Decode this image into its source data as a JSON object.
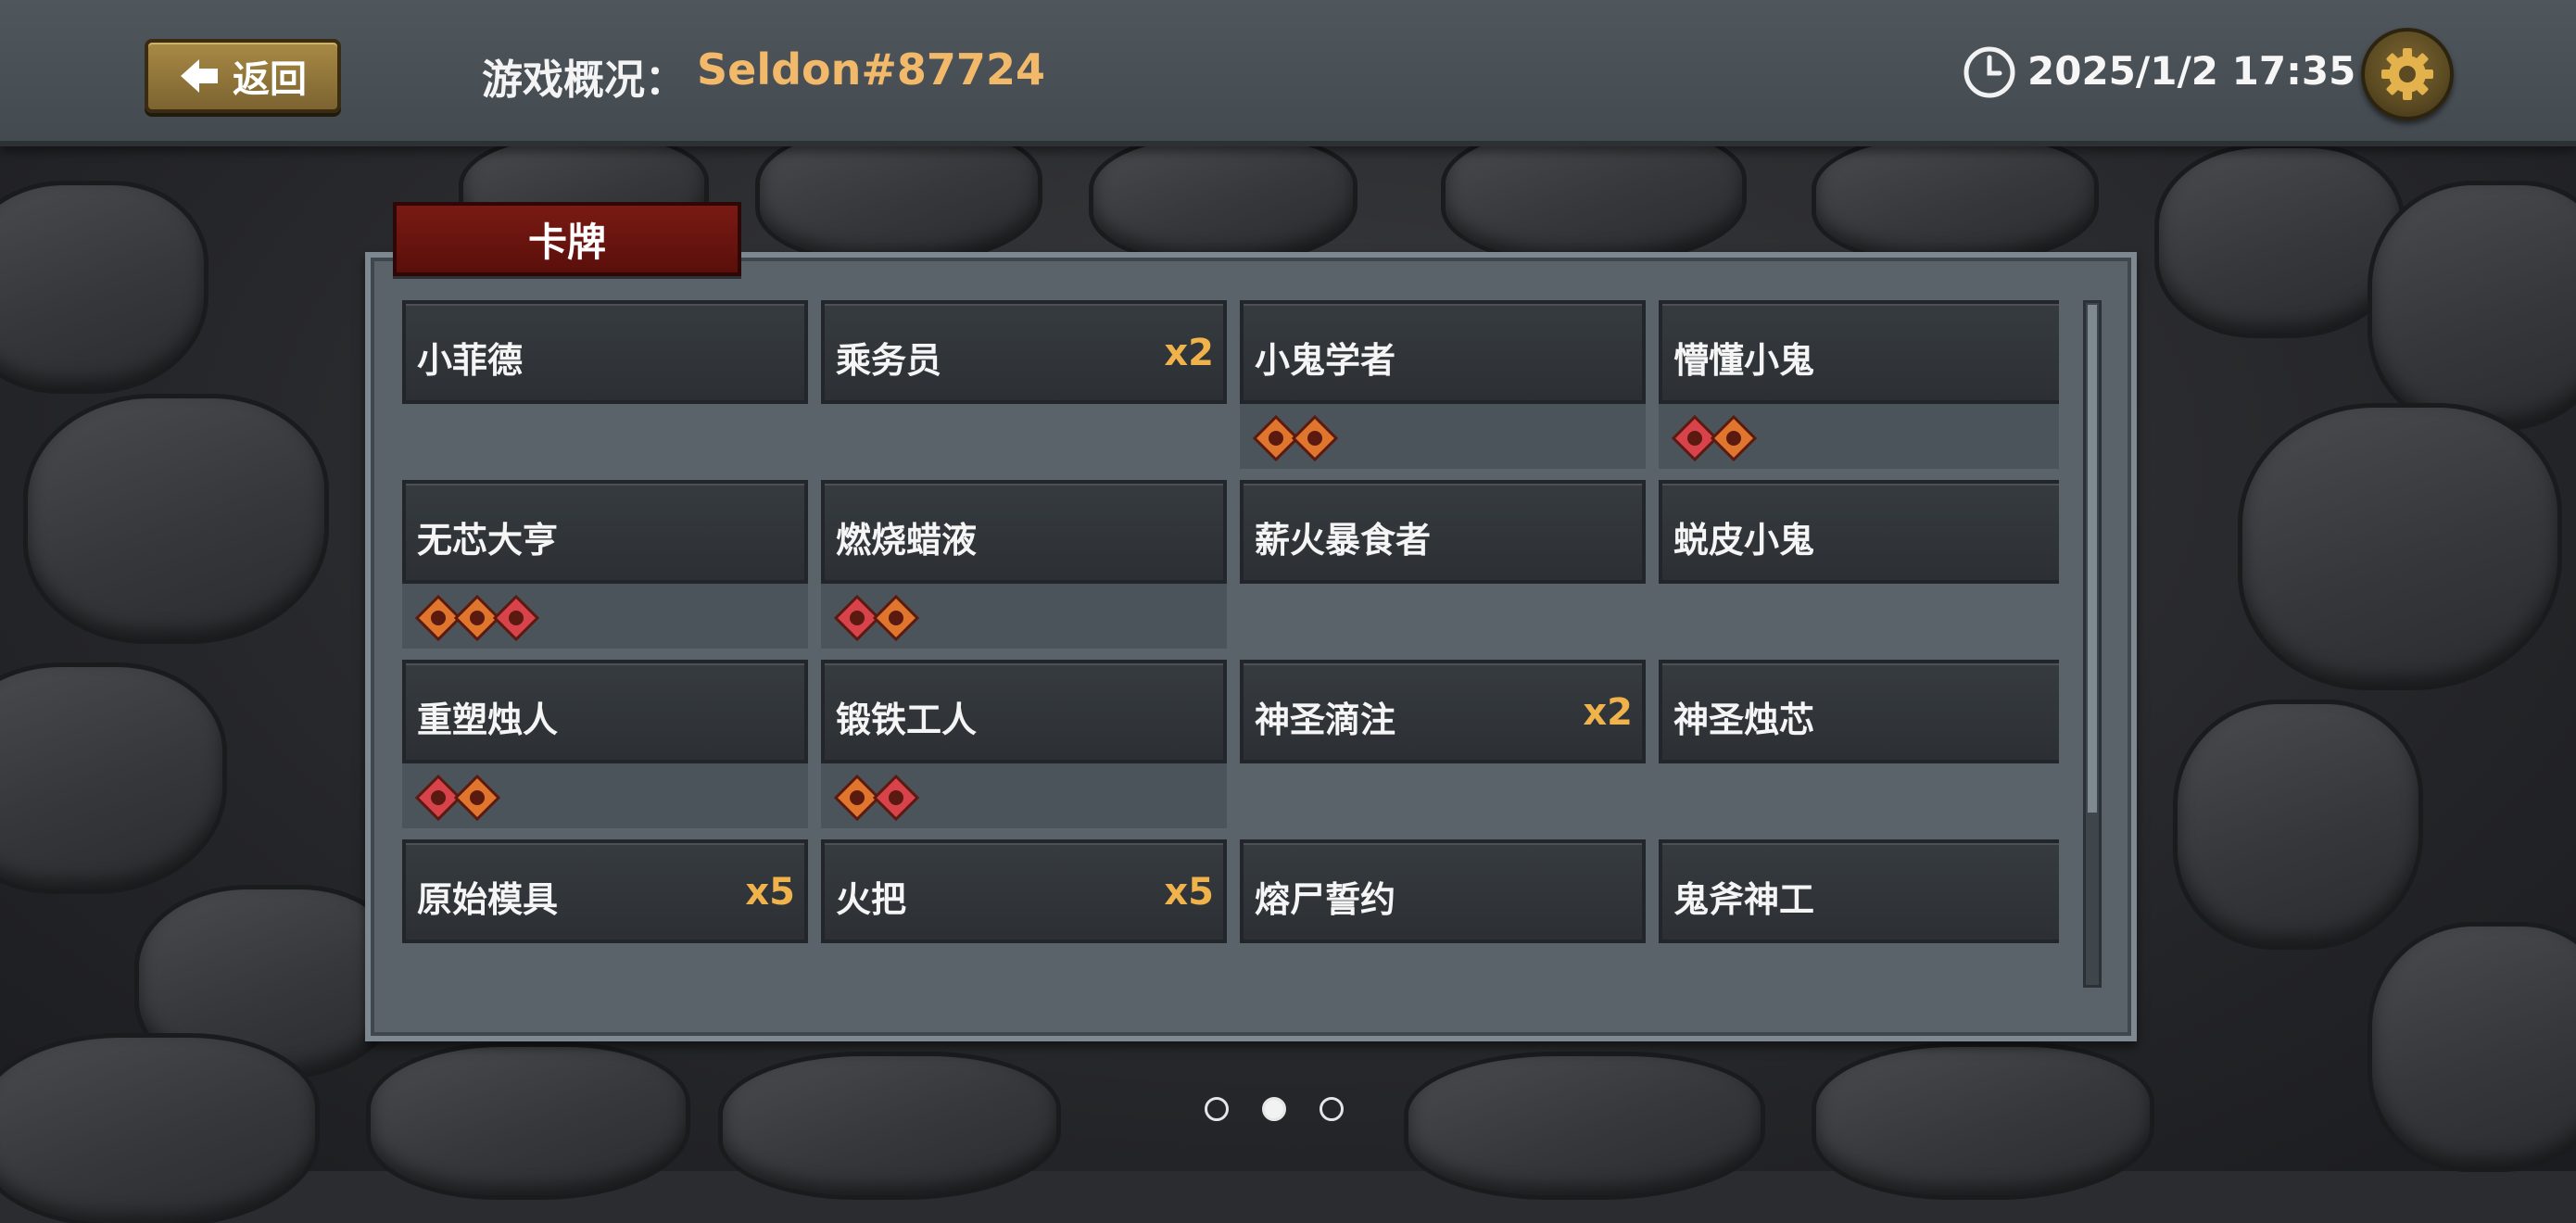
{
  "header": {
    "back_label": "返回",
    "title_prefix": "游戏概况：",
    "username": "Seldon#87724",
    "datetime": "2025/1/2 17:35",
    "icons": {
      "back": "left-arrow-icon",
      "clock": "clock-icon",
      "settings": "gear-icon"
    }
  },
  "panel": {
    "tab_label": "卡牌",
    "cards": [
      {
        "name": "小菲德",
        "count": "",
        "badges": []
      },
      {
        "name": "乘务员",
        "count": "x2",
        "badges": []
      },
      {
        "name": "小鬼学者",
        "count": "",
        "badges": [
          "skull-badge-icon",
          "heart-badge-icon"
        ]
      },
      {
        "name": "懵懂小鬼",
        "count": "",
        "badges": [
          "sword-badge-icon",
          "dagger-badge-icon"
        ]
      },
      {
        "name": "无芯大亨",
        "count": "",
        "badges": [
          "cup-badge-icon",
          "dagger-badge-icon",
          "gem-badge-icon"
        ]
      },
      {
        "name": "燃烧蜡液",
        "count": "",
        "badges": [
          "infinity-badge-icon",
          "skull-badge-icon"
        ]
      },
      {
        "name": "薪火暴食者",
        "count": "",
        "badges": []
      },
      {
        "name": "蜕皮小鬼",
        "count": "",
        "badges": []
      },
      {
        "name": "重塑烛人",
        "count": "",
        "badges": [
          "sword-badge-icon",
          "dagger-badge-icon"
        ]
      },
      {
        "name": "锻铁工人",
        "count": "",
        "badges": [
          "cup-badge-icon",
          "scroll-badge-icon"
        ]
      },
      {
        "name": "神圣滴注",
        "count": "x2",
        "badges": []
      },
      {
        "name": "神圣烛芯",
        "count": "",
        "badges": []
      },
      {
        "name": "原始模具",
        "count": "x5",
        "badges": []
      },
      {
        "name": "火把",
        "count": "x5",
        "badges": []
      },
      {
        "name": "熔尸誓约",
        "count": "",
        "badges": []
      },
      {
        "name": "鬼斧神工",
        "count": "",
        "badges": []
      },
      {
        "name": "",
        "count": "",
        "badges": []
      },
      {
        "name": "",
        "count": "",
        "badges": []
      },
      {
        "name": "",
        "count": "",
        "badges": []
      },
      {
        "name": "",
        "count": "",
        "badges": []
      }
    ]
  },
  "pager": {
    "pages": 3,
    "current": 2
  },
  "colors": {
    "accent_username": "#f2b96b",
    "count": "#f0b24a",
    "tab": "#6a140f",
    "badge_orange": "#e0762e",
    "badge_red": "#d8424a"
  }
}
